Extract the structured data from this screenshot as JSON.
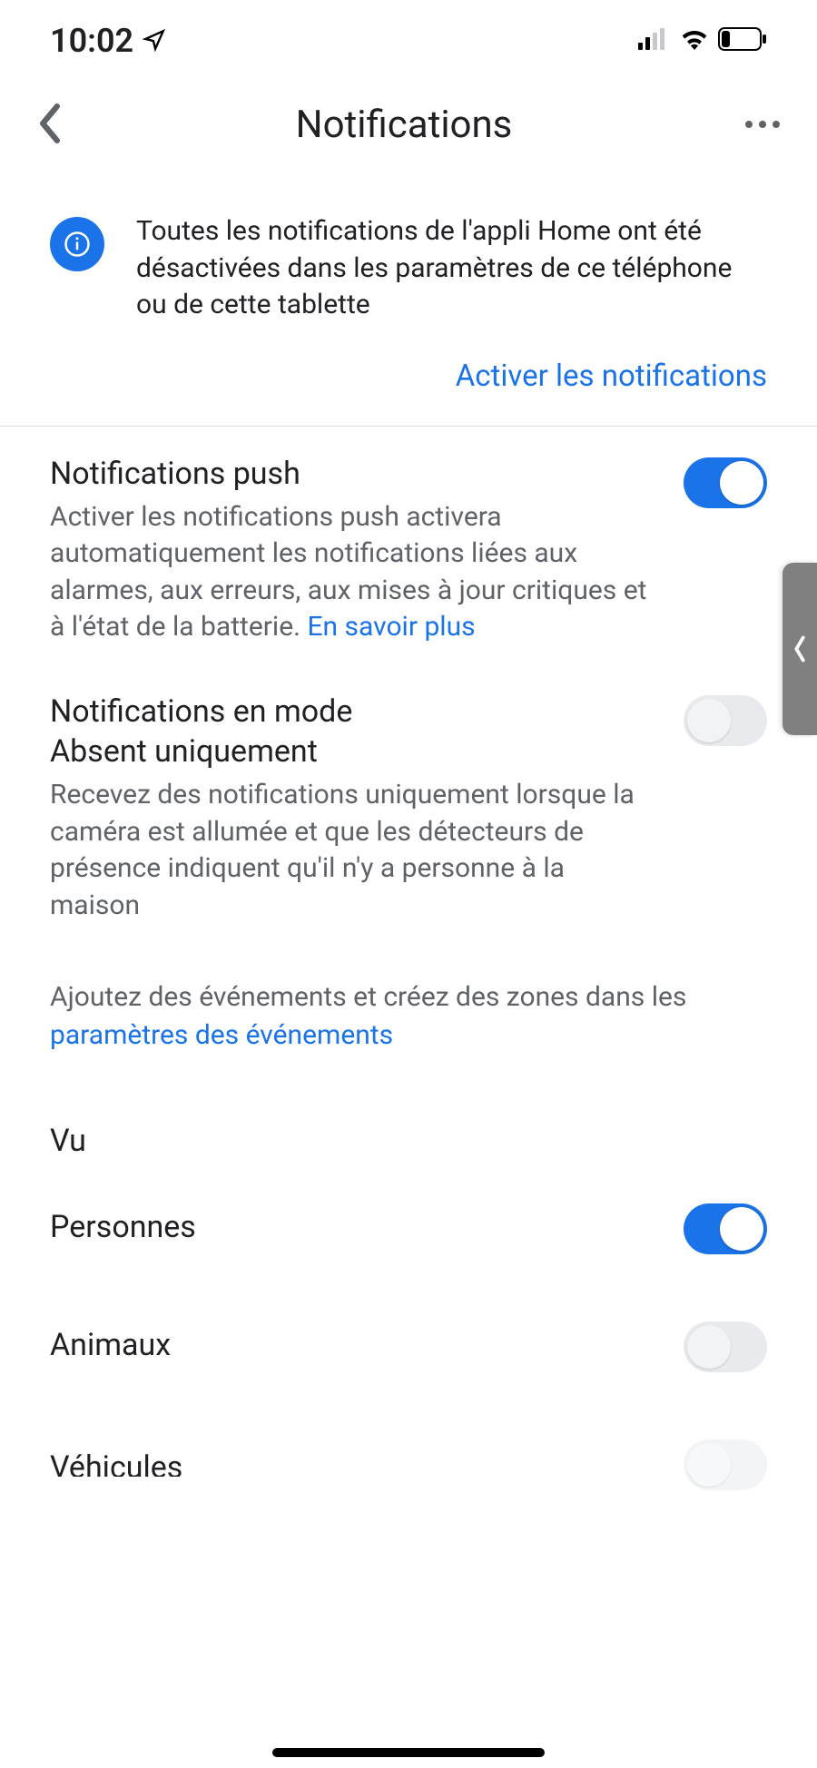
{
  "status": {
    "time": "10:02"
  },
  "header": {
    "title": "Notifications"
  },
  "banner": {
    "text": "Toutes les notifications de l'appli Home ont été désactivées dans les paramètres de ce téléphone ou de cette tablette",
    "action": "Activer les notifications"
  },
  "settings": {
    "push": {
      "title": "Notifications push",
      "desc_pre": "Activer les notifications push activera automatiquement les notifications liées aux alarmes, aux erreurs, aux mises à jour critiques et à l'état de la batterie. ",
      "desc_link": "En savoir plus",
      "on": true
    },
    "away": {
      "title": "Notifications en mode Absent uniquement",
      "desc": "Recevez des notifications uniquement lorsque la caméra est allumée et que les détecteurs de présence indiquent qu'il n'y a personne à la maison",
      "on": false
    }
  },
  "hint": {
    "text_pre": "Ajoutez des événements et créez des zones dans les ",
    "text_link": "paramètres des événements"
  },
  "section": {
    "seen": "Vu"
  },
  "items": {
    "persons": {
      "label": "Personnes",
      "on": true
    },
    "animals": {
      "label": "Animaux",
      "on": false
    },
    "vehicles": {
      "label": "Véhicules",
      "on": false
    }
  }
}
